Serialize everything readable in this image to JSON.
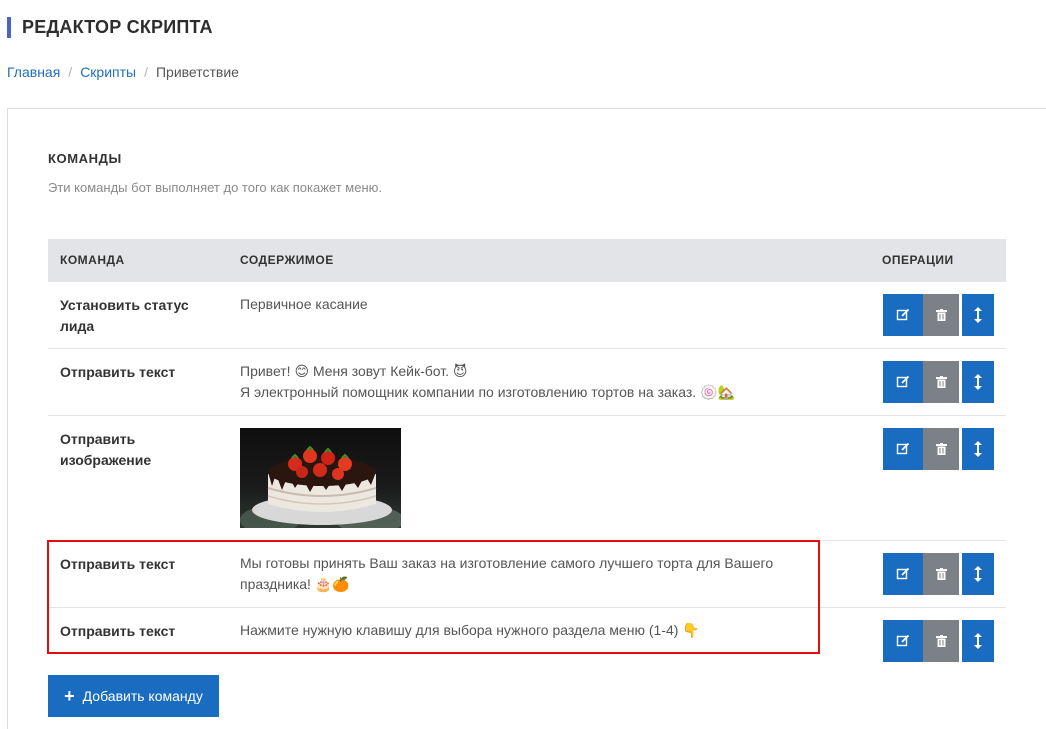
{
  "header": {
    "title": "РЕДАКТОР СКРИПТА"
  },
  "breadcrumb": {
    "home": "Главная",
    "scripts": "Скрипты",
    "current": "Приветствие"
  },
  "section": {
    "title": "КОМАНДЫ",
    "description": "Эти команды бот выполняет до того как покажет меню."
  },
  "table": {
    "columns": {
      "command": "КОМАНДА",
      "content": "СОДЕРЖИМОЕ",
      "operations": "ОПЕРАЦИИ"
    },
    "rows": [
      {
        "command": "Установить статус лида",
        "content_lines": [
          "Первичное касание"
        ]
      },
      {
        "command": "Отправить текст",
        "content_lines": [
          "Привет! 😊 Меня зовут Кейк-бот. 😈",
          "Я электронный помощник компании по изготовлению тортов на заказ. 🍥🏡"
        ]
      },
      {
        "command": "Отправить изображение",
        "content_image": "cake-photo"
      },
      {
        "command": "Отправить текст",
        "content_lines": [
          "Мы готовы принять Ваш заказ на изготовление самого лучшего торта для Вашего",
          "праздника! 🎂🍊"
        ]
      },
      {
        "command": "Отправить текст",
        "content_lines": [
          "Нажмите нужную клавишу для выбора нужного раздела меню (1-4) 👇"
        ]
      }
    ]
  },
  "add_button": {
    "label": "Добавить команду",
    "icon": "plus-icon"
  },
  "icons": {
    "edit": "edit-icon",
    "delete": "trash-icon",
    "move": "vertical-arrows-icon"
  },
  "colors": {
    "primary": "#1a6cc1",
    "secondary": "#7b8187",
    "highlight": "#e30d0d",
    "header_bar": "#4a63c9"
  }
}
